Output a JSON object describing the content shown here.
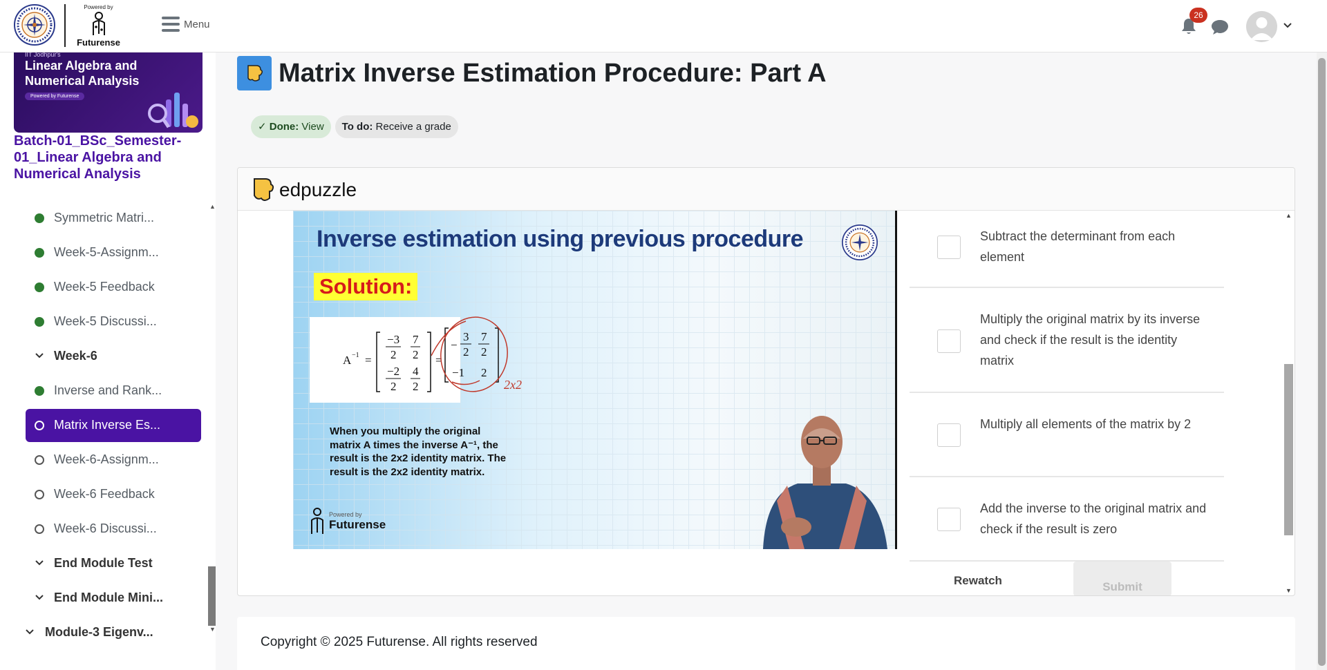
{
  "navbar": {
    "powered_by": "Powered by",
    "brand": "Futurense",
    "menu_label": "Menu",
    "notification_count": "26"
  },
  "sidebar": {
    "banner": {
      "small": "IIT Jodhpur's",
      "title": "Linear Algebra and Numerical Analysis",
      "pill": "Powered by Futurense"
    },
    "course_name": "Batch-01_BSc_Semester-01_Linear Algebra and Numerical Analysis",
    "items": [
      {
        "label": "Symmetric Matri...",
        "status": "done"
      },
      {
        "label": "Week-5-Assignm...",
        "status": "done"
      },
      {
        "label": "Week-5 Feedback",
        "status": "done"
      },
      {
        "label": "Week-5 Discussi...",
        "status": "done"
      },
      {
        "label": "Week-6",
        "status": "section"
      },
      {
        "label": "Inverse and Rank...",
        "status": "done"
      },
      {
        "label": "Matrix Inverse Es...",
        "status": "active"
      },
      {
        "label": "Week-6-Assignm...",
        "status": "todo"
      },
      {
        "label": "Week-6 Feedback",
        "status": "todo"
      },
      {
        "label": "Week-6 Discussi...",
        "status": "todo"
      },
      {
        "label": "End Module Test",
        "status": "section"
      },
      {
        "label": "End Module Mini...",
        "status": "section"
      },
      {
        "label": "Module-3 Eigenv...",
        "status": "module"
      }
    ]
  },
  "page": {
    "title": "Matrix Inverse Estimation Procedure: Part A",
    "completion": {
      "done_label": "Done:",
      "done_value": "View",
      "todo_label": "To do:",
      "todo_value": "Receive a grade"
    }
  },
  "edpuzzle": {
    "logo_text": "edpuzzle",
    "slide": {
      "title": "Inverse estimation using previous procedure",
      "solution": "Solution:",
      "text": "When you multiply the original matrix A times the inverse A⁻¹, the result is the 2x2 identity matrix. The result is the 2x2 identity matrix.",
      "brand_small": "Powered by",
      "brand": "Futurense",
      "annotation": "2x2"
    },
    "options": [
      "Subtract the determinant from each element",
      "Multiply the original matrix by its inverse and check if the result is the identity matrix",
      "Multiply all elements of the matrix by 2",
      "Add the inverse to the original matrix and check if the result is zero"
    ],
    "rewatch": "Rewatch",
    "submit": "Submit"
  },
  "footer": {
    "copyright": "Copyright © 2025 Futurense. All rights reserved"
  },
  "colors": {
    "brand_purple": "#4a13a3",
    "done_green": "#2e7d32",
    "badge_red": "#ca3120"
  }
}
